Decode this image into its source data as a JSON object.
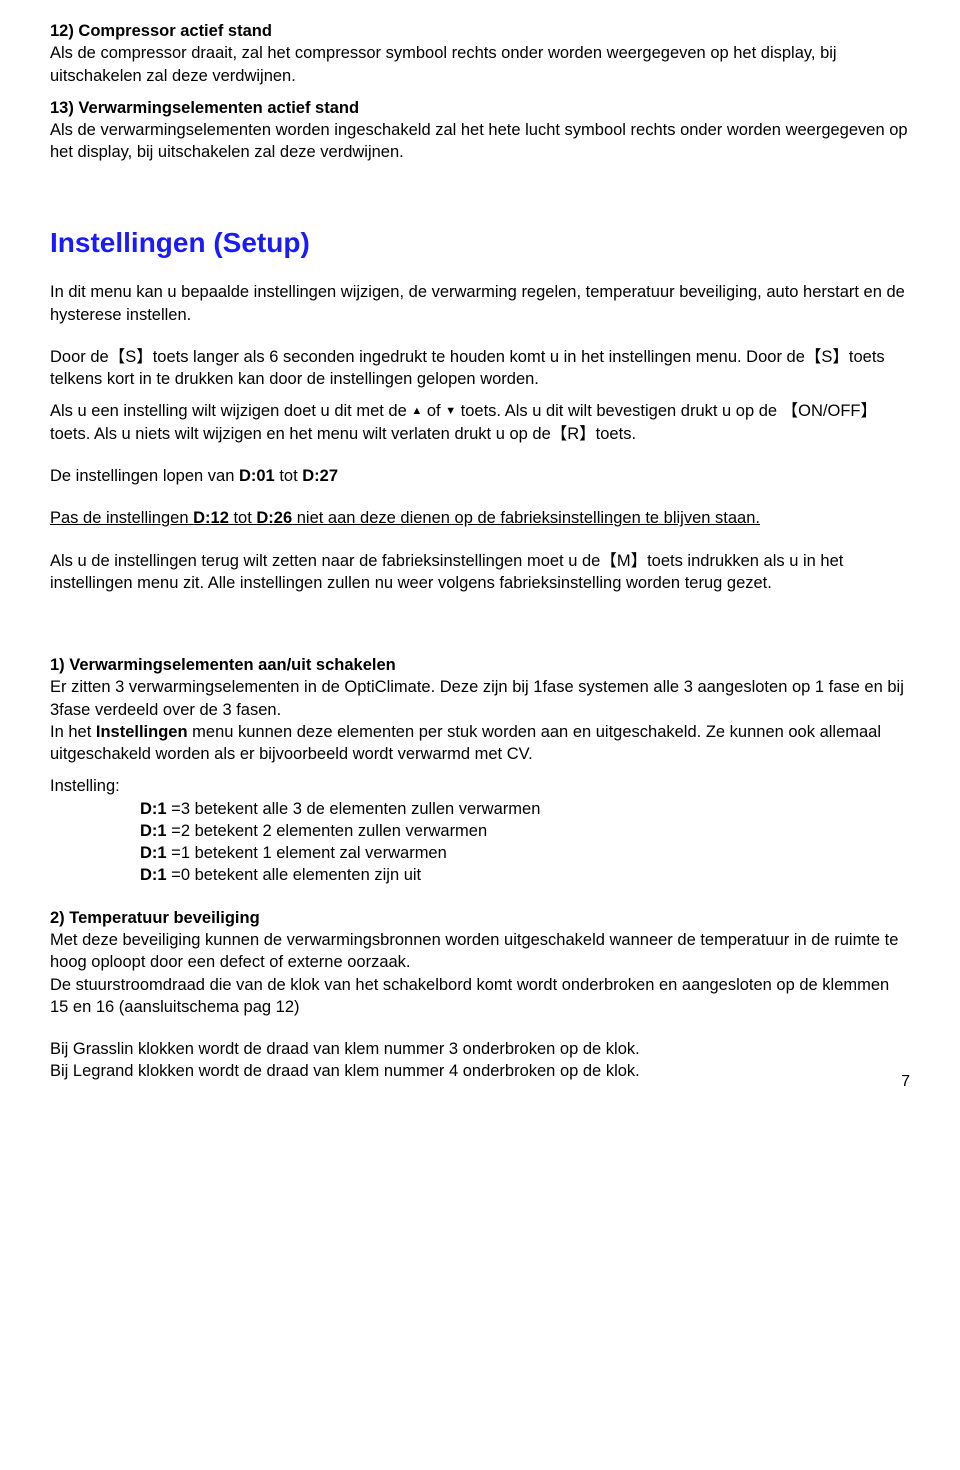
{
  "s12": {
    "title": "12) Compressor actief stand",
    "body": "Als de compressor draait, zal het compressor symbool rechts onder worden weergegeven op het display, bij uitschakelen zal deze verdwijnen."
  },
  "s13": {
    "title": "13) Verwarmingselementen actief stand",
    "body": "Als de verwarmingselementen worden ingeschakeld zal het hete lucht symbool rechts onder worden weergegeven op het display, bij uitschakelen zal deze verdwijnen."
  },
  "setup": {
    "heading": "Instellingen (Setup)",
    "p1": "In dit menu kan u bepaalde instellingen wijzigen, de verwarming regelen, temperatuur beveiliging, auto herstart en de hysterese instellen.",
    "p2": "Door de【S】toets langer als 6 seconden ingedrukt te houden komt u in het instellingen menu. Door de【S】toets telkens kort in te drukken kan door de instellingen gelopen worden.",
    "p3a": "Als u een instelling wilt wijzigen doet u dit met de ",
    "p3b": " of ",
    "p3c": " toets. Als u dit wilt bevestigen drukt u op de 【ON/OFF】toets. Als u niets wilt wijzigen en het menu wilt verlaten drukt u op de【R】toets.",
    "p4a": "De instellingen lopen van ",
    "p4b": "D:01",
    "p4c": " tot ",
    "p4d": "D:27",
    "p5a": "Pas de instellingen ",
    "p5b": "D:12",
    "p5c": " tot ",
    "p5d": "D:26",
    "p5e": " niet aan deze dienen op de fabrieksinstellingen te blijven staan.",
    "p6": "Als u de instellingen terug wilt zetten naar de fabrieksinstellingen moet u de【M】toets indrukken als u in het instellingen menu zit. Alle instellingen zullen nu weer volgens fabrieksinstelling worden terug gezet."
  },
  "s1": {
    "title": "1) Verwarmingselementen aan/uit schakelen",
    "p1": "Er zitten 3 verwarmingselementen in de OptiClimate. Deze zijn bij 1fase systemen alle 3 aangesloten op 1 fase en bij 3fase verdeeld over de 3 fasen.",
    "p2a": "In het ",
    "p2b": "Instellingen",
    "p2c": " menu kunnen deze elementen per stuk worden aan en uitgeschakeld. Ze kunnen ook allemaal uitgeschakeld worden als er bijvoorbeeld wordt verwarmd met CV.",
    "instelling_label": "Instelling:",
    "d1": {
      "k": "D:1",
      "r": " =3 betekent alle 3 de elementen zullen verwarmen"
    },
    "d2": {
      "k": "D:1",
      "r": " =2 betekent 2 elementen zullen verwarmen"
    },
    "d3": {
      "k": "D:1",
      "r": " =1 betekent 1 element zal verwarmen"
    },
    "d4": {
      "k": "D:1",
      "r": " =0 betekent alle elementen zijn uit"
    }
  },
  "s2": {
    "title": "2) Temperatuur beveiliging",
    "p1": "Met deze beveiliging kunnen de verwarmingsbronnen worden uitgeschakeld wanneer de temperatuur in de ruimte te hoog oploopt door een defect of externe oorzaak.",
    "p2": "De stuurstroomdraad die van de klok van het schakelbord komt wordt onderbroken en aangesloten op de klemmen 15 en 16 (aansluitschema pag 12)",
    "p3": "Bij Grasslin klokken wordt de draad van klem nummer 3 onderbroken op de klok.",
    "p4": "Bij Legrand klokken wordt de draad van klem nummer 4 onderbroken op de klok."
  },
  "page_number": "7",
  "icons": {
    "up": "▲",
    "down": "▼"
  }
}
